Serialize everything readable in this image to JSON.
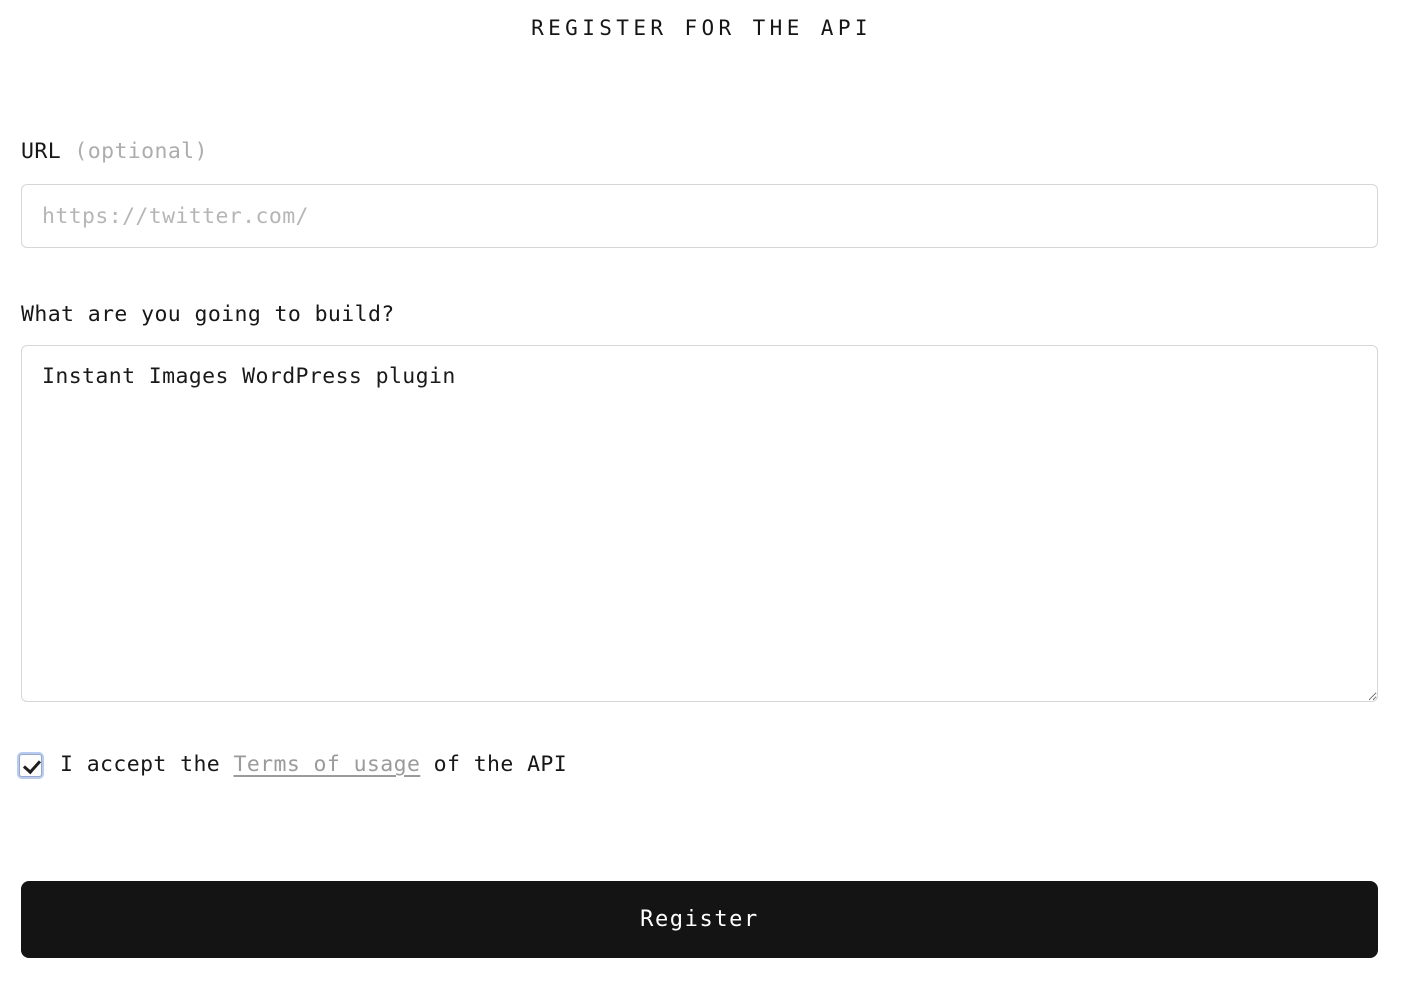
{
  "form": {
    "title": "REGISTER FOR THE API",
    "url_field": {
      "label_main": "URL",
      "label_optional": "(optional)",
      "placeholder": "https://twitter.com/",
      "value": ""
    },
    "build_field": {
      "label": "What are you going to build?",
      "placeholder": "",
      "value": "Instant Images WordPress plugin"
    },
    "terms": {
      "checked": true,
      "text_before": "I accept the ",
      "link_label": "Terms of usage",
      "text_after": " of the API"
    },
    "submit": {
      "label": "Register"
    }
  },
  "colors": {
    "page_background": "#ffffff",
    "text": "#171717",
    "muted_text": "#adadad",
    "placeholder": "#b6b6b6",
    "input_border": "#d6d6d6",
    "link": "#9b9b9b",
    "button_background": "#141414",
    "button_text": "#ffffff",
    "checkbox_focus_ring": "#b8cbf0"
  }
}
